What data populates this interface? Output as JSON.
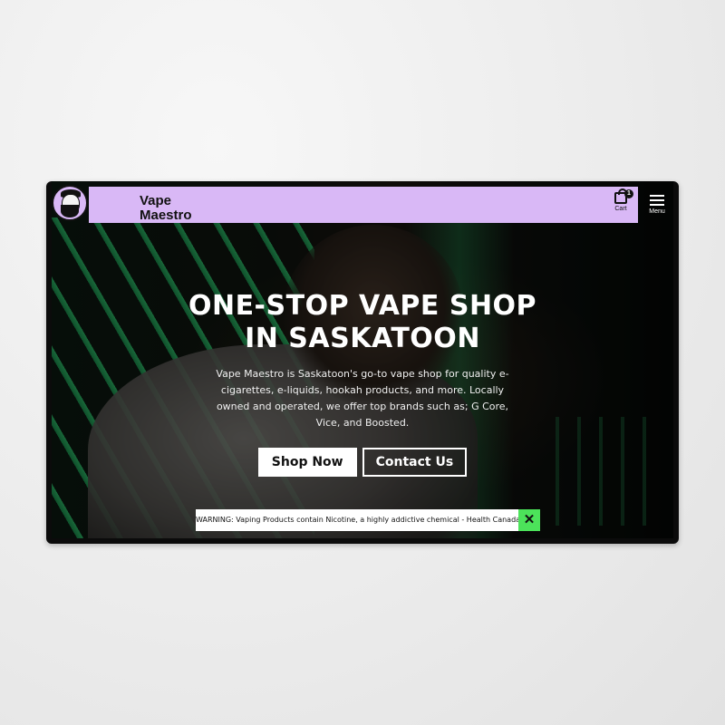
{
  "header": {
    "brand_line1": "Vape",
    "brand_line2": "Maestro",
    "cart_count": "1",
    "cart_label": "Cart",
    "menu_label": "Menu",
    "background_color": "#d9b8f6"
  },
  "hero": {
    "headline_line1": "ONE-STOP VAPE SHOP",
    "headline_line2": "IN SASKATOON",
    "description": "Vape Maestro is Saskatoon's go-to vape shop for quality e-cigarettes, e-liquids, hookah products, and more. Locally owned and operated, we offer top brands such as; G Core, Vice, and Boosted.",
    "primary_button": "Shop Now",
    "secondary_button": "Contact Us"
  },
  "warning": {
    "text": "WARNING: Vaping Products contain Nicotine, a highly addictive chemical - Health Canada",
    "close_icon": "close-icon",
    "close_color": "#4ce35a"
  }
}
